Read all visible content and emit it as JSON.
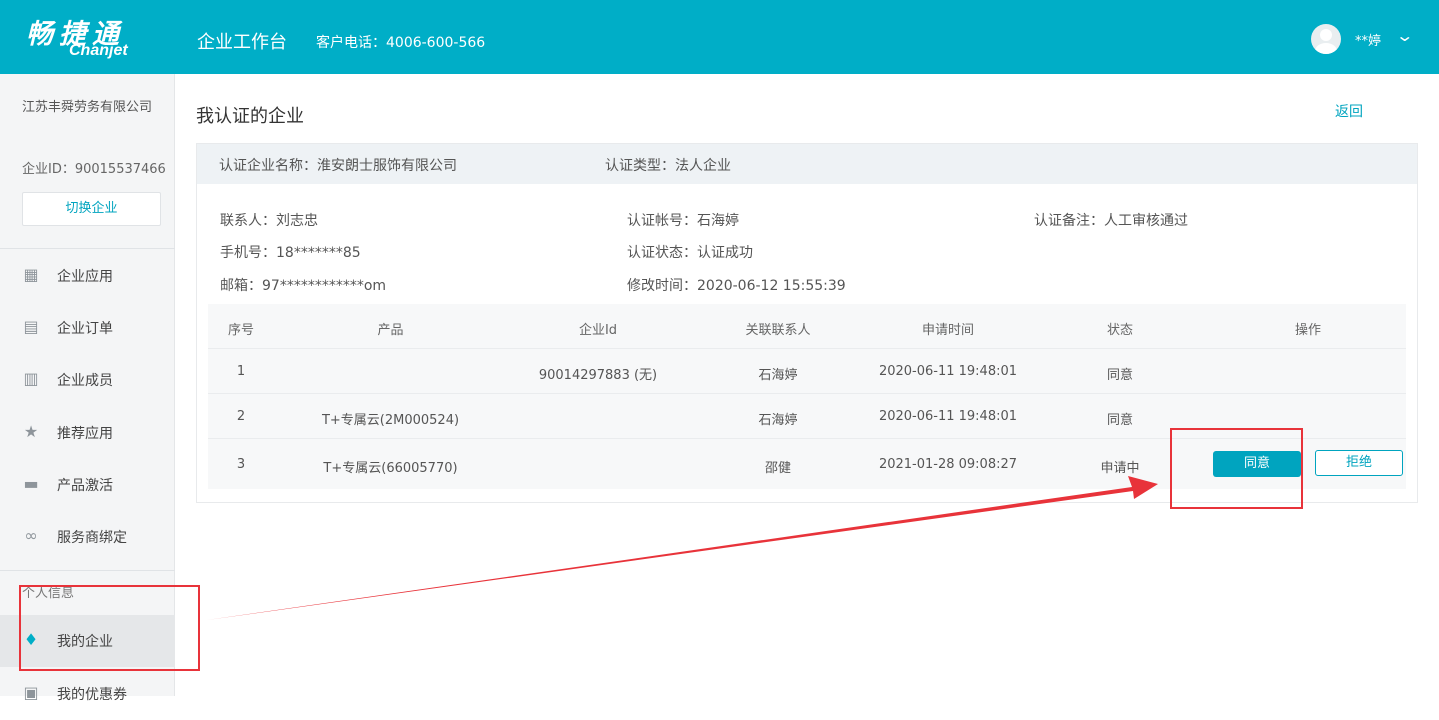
{
  "header": {
    "logo_cn": "畅捷通",
    "logo_en": "Chanjet",
    "app_title": "企业工作台",
    "phone": "客户电话：4006-600-566",
    "username": "**婷",
    "chevron": "⌄"
  },
  "sidebar": {
    "company_name": "江苏丰舜劳务有限公司",
    "company_id": "企业ID：90015537466",
    "switch_label": "切换企业",
    "items": [
      {
        "label": "企业应用",
        "icon": "apps-icon",
        "glyph": "▦"
      },
      {
        "label": "企业订单",
        "icon": "clipboard-icon",
        "glyph": "▤"
      },
      {
        "label": "企业成员",
        "icon": "building-icon",
        "glyph": "▥"
      },
      {
        "label": "推荐应用",
        "icon": "star-icon",
        "glyph": "★"
      },
      {
        "label": "产品激活",
        "icon": "ticket-icon",
        "glyph": "▬"
      },
      {
        "label": "服务商绑定",
        "icon": "link-icon",
        "glyph": "∞"
      }
    ],
    "section_label": "个人信息",
    "personal_items": [
      {
        "label": "我的企业",
        "icon": "tie-icon",
        "glyph": "♦",
        "active": true
      },
      {
        "label": "我的优惠券",
        "icon": "coupon-icon",
        "glyph": "▣"
      }
    ]
  },
  "main": {
    "title": "我认证的企业",
    "back_label": "返回",
    "head": {
      "company": "认证企业名称：淮安朗士服饰有限公司",
      "type": "认证类型：法人企业"
    },
    "info": {
      "contact": "联系人：刘志忠",
      "account": "认证帐号：石海婷",
      "remark": "认证备注：人工审核通过",
      "mobile": "手机号：18*******85",
      "status": "认证状态：认证成功",
      "email": "邮箱：97************om",
      "modified": "修改时间：2020-06-12 15:55:39"
    },
    "table": {
      "columns": [
        "序号",
        "产品",
        "企业Id",
        "关联联系人",
        "申请时间",
        "状态",
        "操作"
      ],
      "rows": [
        {
          "no": "1",
          "product": "",
          "eid": "90014297883 (无)",
          "contact": "石海婷",
          "time": "2020-06-11 19:48:01",
          "status": "同意"
        },
        {
          "no": "2",
          "product": "T+专属云(2M000524)",
          "eid": "",
          "contact": "石海婷",
          "time": "2020-06-11 19:48:01",
          "status": "同意"
        },
        {
          "no": "3",
          "product": "T+专属云(66005770)",
          "eid": "",
          "contact": "邵健",
          "time": "2021-01-28 09:08:27",
          "status": "申请中"
        }
      ],
      "agree_label": "同意",
      "reject_label": "拒绝"
    }
  },
  "colors": {
    "brand": "#00aec7",
    "link": "#00a4bf",
    "annotation": "#e8333a"
  }
}
